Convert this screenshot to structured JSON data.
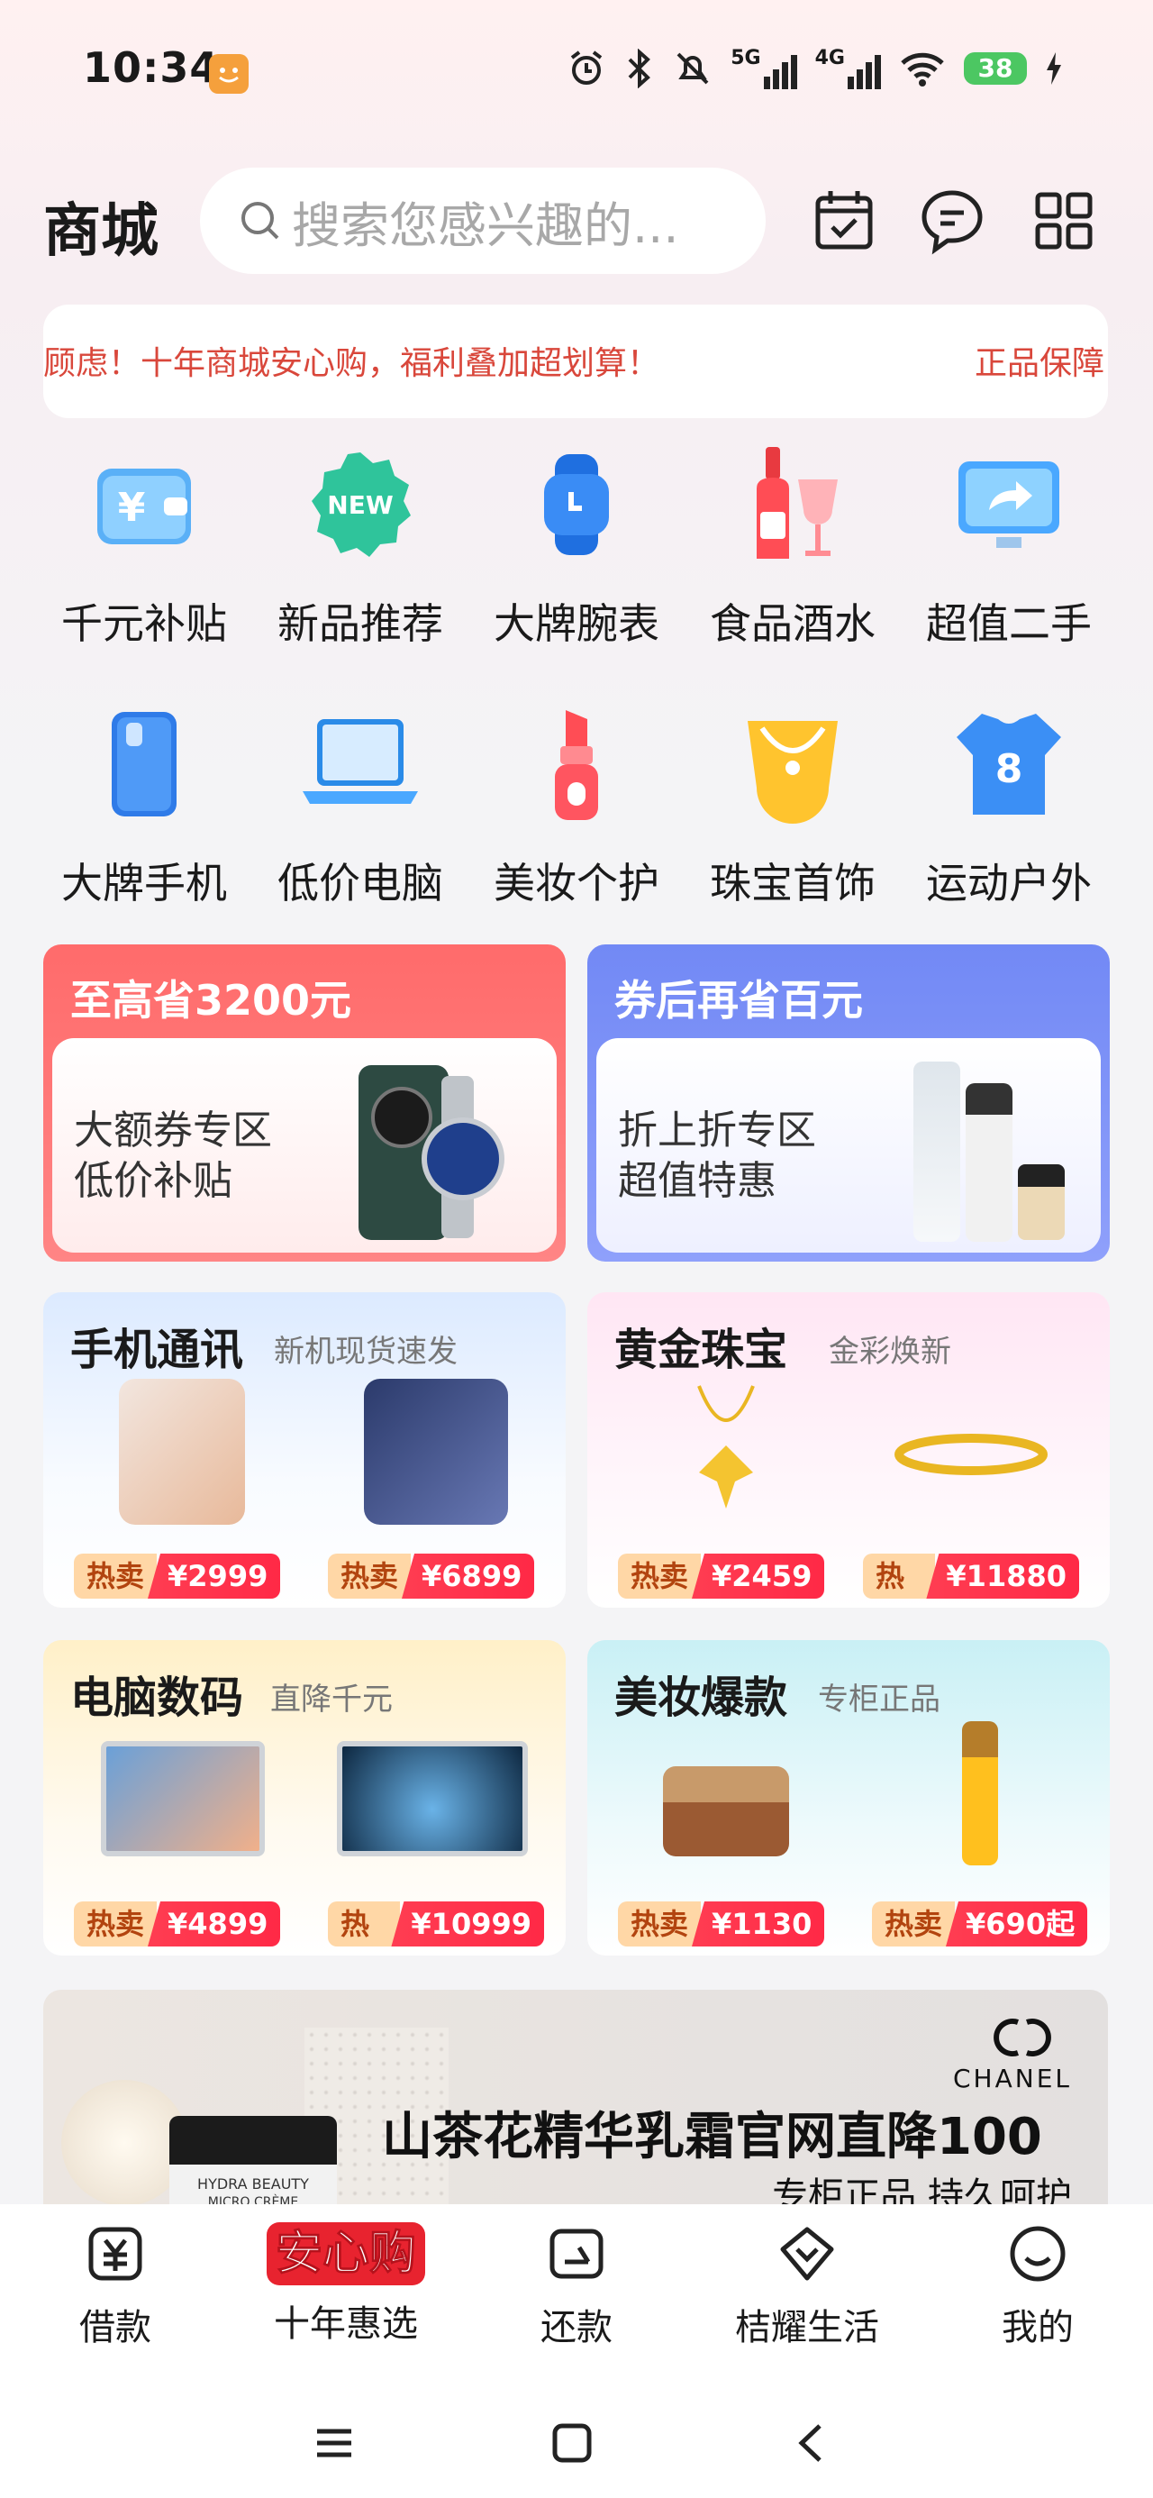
{
  "status": {
    "time": "10:34",
    "battery": "38",
    "signal1": "5G",
    "signal2": "4G"
  },
  "header": {
    "title": "商城",
    "search_placeholder": "搜索您感兴趣的..."
  },
  "notice": {
    "text": "顾虑！十年商城安心购，福利叠加超划算！",
    "guarantee": "正品保障"
  },
  "categories": [
    {
      "label": "千元补贴"
    },
    {
      "label": "新品推荐",
      "badge": "NEW"
    },
    {
      "label": "大牌腕表"
    },
    {
      "label": "食品酒水"
    },
    {
      "label": "超值二手"
    },
    {
      "label": "大牌手机"
    },
    {
      "label": "低价电脑"
    },
    {
      "label": "美妆个护"
    },
    {
      "label": "珠宝首饰"
    },
    {
      "label": "运动户外",
      "badge": "8"
    }
  ],
  "promos": [
    {
      "head": "至高省3200元",
      "line1": "大额券专区",
      "line2": "低价补贴"
    },
    {
      "head": "券后再省百元",
      "line1": "折上折专区",
      "line2": "超值特惠"
    }
  ],
  "product_cards": [
    {
      "name": "手机通讯",
      "sub": "新机现货速发",
      "items": [
        {
          "tag": "热卖",
          "price": "¥2999"
        },
        {
          "tag": "热卖",
          "price": "¥6899"
        }
      ]
    },
    {
      "name": "黄金珠宝",
      "sub": "金彩焕新",
      "items": [
        {
          "tag": "热卖",
          "price": "¥2459"
        },
        {
          "tag": "热卖",
          "price": "¥11880"
        }
      ]
    },
    {
      "name": "电脑数码",
      "sub": "直降千元",
      "items": [
        {
          "tag": "热卖",
          "price": "¥4899"
        },
        {
          "tag": "热卖",
          "price": "¥10999"
        }
      ]
    },
    {
      "name": "美妆爆款",
      "sub": "专柜正品",
      "items": [
        {
          "tag": "热卖",
          "price": "¥1130"
        },
        {
          "tag": "热卖",
          "price": "¥690起"
        }
      ]
    }
  ],
  "banner": {
    "brand": "CHANEL",
    "title": "山茶花精华乳霜官网直降100",
    "subtitle": "专柜正品 持久呵护",
    "jar_text1": "HYDRA BEAUTY",
    "jar_text2": "MICRO CRÈME"
  },
  "nav": [
    {
      "label": "借款"
    },
    {
      "label": "十年惠选",
      "badge": "安心购"
    },
    {
      "label": "还款"
    },
    {
      "label": "桔耀生活"
    },
    {
      "label": "我的"
    }
  ],
  "colors": {
    "accent_red": "#ff2946",
    "notice_red": "#d9473b",
    "promo_left": "#ff6b6b",
    "promo_right": "#7b8ff7"
  }
}
